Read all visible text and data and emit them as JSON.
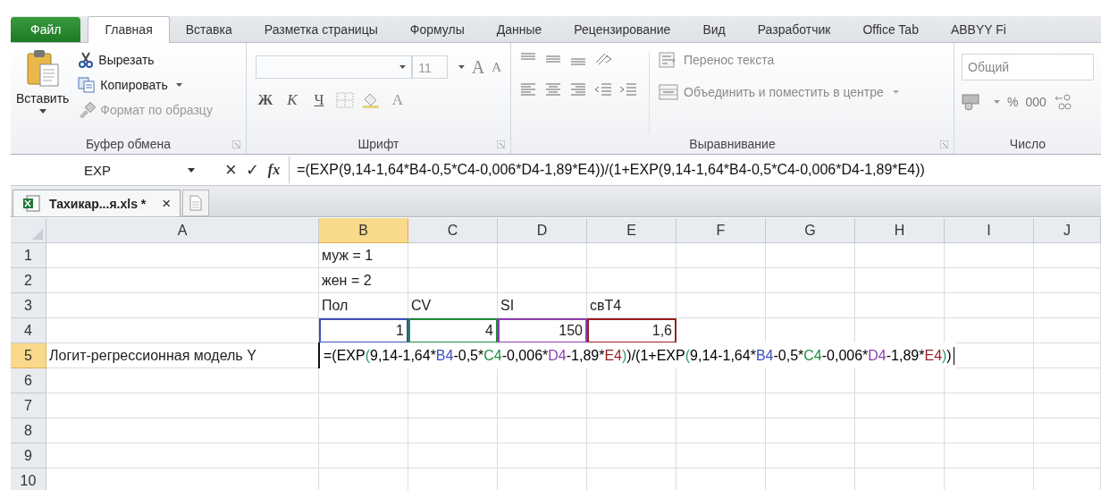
{
  "ribbon_tabs": [
    {
      "label": "Файл",
      "kind": "file",
      "selected": false
    },
    {
      "label": "Главная",
      "kind": "tab",
      "selected": true
    },
    {
      "label": "Вставка",
      "kind": "tab",
      "selected": false
    },
    {
      "label": "Разметка страницы",
      "kind": "tab",
      "selected": false
    },
    {
      "label": "Формулы",
      "kind": "tab",
      "selected": false
    },
    {
      "label": "Данные",
      "kind": "tab",
      "selected": false
    },
    {
      "label": "Рецензирование",
      "kind": "tab",
      "selected": false
    },
    {
      "label": "Вид",
      "kind": "tab",
      "selected": false
    },
    {
      "label": "Разработчик",
      "kind": "tab",
      "selected": false
    },
    {
      "label": "Office Tab",
      "kind": "tab",
      "selected": false
    },
    {
      "label": "ABBYY Fi",
      "kind": "tab",
      "selected": false
    }
  ],
  "clipboard": {
    "paste": "Вставить",
    "cut": {
      "label": "Вырезать",
      "disabled": false
    },
    "copy": {
      "label": "Копировать",
      "disabled": false
    },
    "format_painter": {
      "label": "Формат по образцу",
      "disabled": true
    },
    "group": "Буфер обмена"
  },
  "font": {
    "size": "11",
    "grow": "A",
    "shrink": "A",
    "bold": "Ж",
    "italic": "К",
    "underline": "Ч",
    "font_color": "A",
    "group": "Шрифт"
  },
  "alignment": {
    "wrap": {
      "label": "Перенос текста",
      "disabled": true
    },
    "merge": {
      "label": "Объединить и поместить в центре",
      "disabled": true
    },
    "group": "Выравнивание"
  },
  "number": {
    "format": "Общий",
    "percent": "%",
    "thousands": "000",
    "group": "Число"
  },
  "formula_bar": {
    "name_box": "EXP",
    "cancel": "×",
    "enter": "✓",
    "fx": "fx",
    "formula": "=(EXP(9,14-1,64*B4-0,5*C4-0,006*D4-1,89*E4))/(1+EXP(9,14-1,64*B4-0,5*C4-0,006*D4-1,89*E4))"
  },
  "documents": [
    {
      "title": "Тахикар...я.xls *",
      "close": "×",
      "selected": true
    }
  ],
  "sheet": {
    "columns": [
      {
        "label": "A",
        "selected": false
      },
      {
        "label": "B",
        "selected": true
      },
      {
        "label": "C",
        "selected": false
      },
      {
        "label": "D",
        "selected": false
      },
      {
        "label": "E",
        "selected": false
      },
      {
        "label": "F",
        "selected": false
      },
      {
        "label": "G",
        "selected": false
      },
      {
        "label": "H",
        "selected": false
      },
      {
        "label": "I",
        "selected": false
      },
      {
        "label": "J",
        "selected": false
      }
    ],
    "rows": [
      {
        "label": "1",
        "selected": false,
        "B": "муж = 1"
      },
      {
        "label": "2",
        "selected": false,
        "B": "жен = 2"
      },
      {
        "label": "3",
        "selected": false,
        "B": "Пол",
        "C": "CV",
        "D": "SI",
        "E": "свТ4"
      },
      {
        "label": "4",
        "selected": false,
        "B": {
          "text": "1",
          "color": "#3d4fb8"
        },
        "C": {
          "text": "4",
          "color": "#1e8c3c"
        },
        "D": {
          "text": "150",
          "color": "#8e3fb0"
        },
        "E": {
          "text": "1,6",
          "color": "#9a1e1e"
        }
      },
      {
        "label": "5",
        "selected": true,
        "A": "Логит-регрессионная модель Y",
        "editing": [
          {
            "text": "=(EXP",
            "color": "#000000"
          },
          {
            "text": "(",
            "color": "#2e9a6a"
          },
          {
            "text": "9,14-1,64*",
            "color": "#000000"
          },
          {
            "text": "B4",
            "color": "#3d4fb8"
          },
          {
            "text": "-0,5*",
            "color": "#000000"
          },
          {
            "text": "C4",
            "color": "#1e8c3c"
          },
          {
            "text": "-0,006*",
            "color": "#000000"
          },
          {
            "text": "D4",
            "color": "#8e3fb0"
          },
          {
            "text": "-1,89*",
            "color": "#000000"
          },
          {
            "text": "E4",
            "color": "#9a1e1e"
          },
          {
            "text": ")",
            "color": "#2e9a6a"
          },
          {
            "text": ")/(1+EXP",
            "color": "#000000"
          },
          {
            "text": "(",
            "color": "#2e9a6a"
          },
          {
            "text": "9,14-1,64*",
            "color": "#000000"
          },
          {
            "text": "B4",
            "color": "#3d4fb8"
          },
          {
            "text": "-0,5*",
            "color": "#000000"
          },
          {
            "text": "C4",
            "color": "#1e8c3c"
          },
          {
            "text": "-0,006*",
            "color": "#000000"
          },
          {
            "text": "D4",
            "color": "#8e3fb0"
          },
          {
            "text": "-1,89*",
            "color": "#000000"
          },
          {
            "text": "E4",
            "color": "#9a1e1e"
          },
          {
            "text": ")",
            "color": "#2e9a6a"
          },
          {
            "text": ")",
            "color": "#000000"
          }
        ]
      },
      {
        "label": "6",
        "selected": false
      },
      {
        "label": "7",
        "selected": false
      },
      {
        "label": "8",
        "selected": false
      },
      {
        "label": "9",
        "selected": false
      },
      {
        "label": "10",
        "selected": false
      }
    ]
  }
}
